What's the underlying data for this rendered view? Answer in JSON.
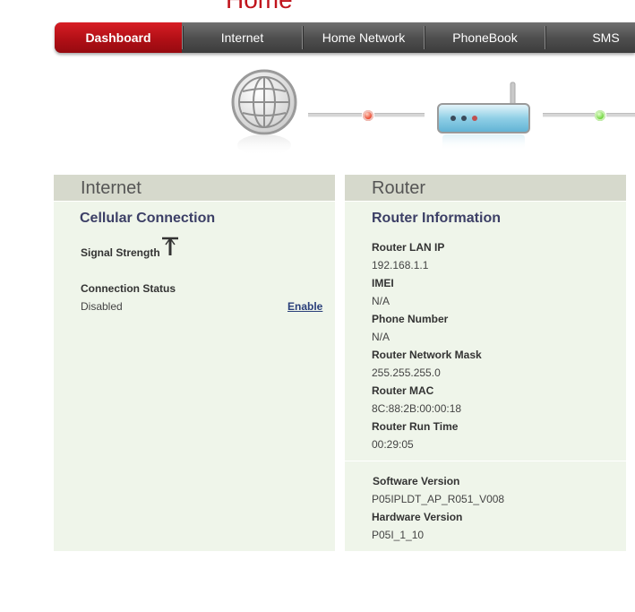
{
  "page": {
    "heading": "Home"
  },
  "nav": {
    "tabs": [
      {
        "label": "Dashboard",
        "active": true
      },
      {
        "label": "Internet",
        "active": false
      },
      {
        "label": "Home Network",
        "active": false
      },
      {
        "label": "PhoneBook",
        "active": false
      },
      {
        "label": "SMS",
        "active": false
      }
    ]
  },
  "diagram": {
    "internet_status_color": "#e8391f",
    "router_status_color": "#5fcf2a"
  },
  "internet_panel": {
    "header": "Internet",
    "section_title": "Cellular Connection",
    "signal_label": "Signal Strength",
    "signal_icon": "antenna-icon",
    "status_label": "Connection Status",
    "status_value": "Disabled",
    "enable_link": "Enable"
  },
  "router_panel": {
    "header": "Router",
    "section_title": "Router Information",
    "fields": [
      {
        "label": "Router LAN IP",
        "value": "192.168.1.1"
      },
      {
        "label": "IMEI",
        "value": "N/A"
      },
      {
        "label": "Phone Number",
        "value": "N/A"
      },
      {
        "label": "Router Network Mask",
        "value": "255.255.255.0"
      },
      {
        "label": "Router MAC",
        "value": "8C:88:2B:00:00:18"
      },
      {
        "label": "Router Run Time",
        "value": "00:29:05"
      }
    ],
    "version_fields": [
      {
        "label": "Software Version",
        "value": "P05IPLDT_AP_R051_V008"
      },
      {
        "label": "Hardware Version",
        "value": "P05I_1_10"
      }
    ]
  }
}
